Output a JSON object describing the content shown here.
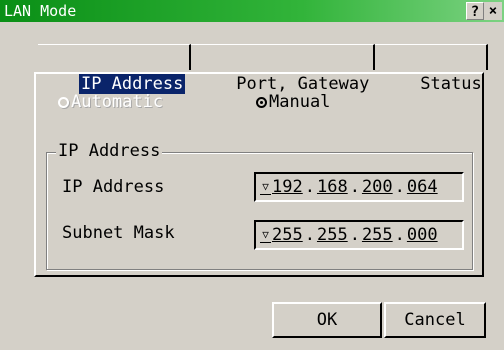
{
  "window": {
    "title": "LAN Mode",
    "help_label": "?",
    "close_label": "×"
  },
  "tabs": [
    {
      "label": "IP Address",
      "active": true
    },
    {
      "label": "Port, Gateway",
      "active": false
    },
    {
      "label": "Status",
      "active": false
    }
  ],
  "mode": {
    "automatic_label": "Automatic",
    "manual_label": "Manual",
    "selected": "Manual"
  },
  "group": {
    "title": "IP Address",
    "ip_label": "IP Address",
    "ip_value": [
      "192",
      "168",
      "200",
      "064"
    ],
    "subnet_label": "Subnet Mask",
    "subnet_value": [
      "255",
      "255",
      "255",
      "000"
    ]
  },
  "buttons": {
    "ok_label": "OK",
    "cancel_label": "Cancel"
  },
  "colors": {
    "title_bar_start": "#0a8f16",
    "title_bar_end": "#7cd282",
    "selected_tab_bg": "#0a246a",
    "window_bg": "#d4d0c8"
  },
  "icons": {
    "dropdown": "down-triangle"
  }
}
